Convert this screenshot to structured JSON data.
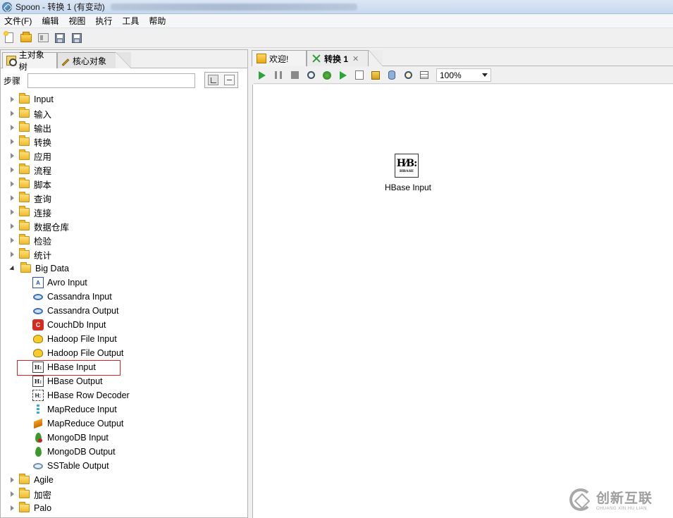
{
  "window": {
    "title": "Spoon - 转换 1 (有变动)"
  },
  "menu": [
    "文件(F)",
    "编辑",
    "视图",
    "执行",
    "工具",
    "帮助"
  ],
  "left_tabs": {
    "main_tree": "主对象树",
    "core_objects": "核心对象"
  },
  "steps": {
    "label": "步骤",
    "value": ""
  },
  "tree": {
    "folders_top": [
      "Input",
      "输入",
      "输出",
      "转换",
      "应用",
      "流程",
      "脚本",
      "查询",
      "连接",
      "数据仓库",
      "检验",
      "统计"
    ],
    "big_data": {
      "label": "Big Data",
      "items": [
        {
          "label": "Avro Input",
          "icon": "avro-icon"
        },
        {
          "label": "Cassandra Input",
          "icon": "cassandra-icon"
        },
        {
          "label": "Cassandra Output",
          "icon": "cassandra-icon"
        },
        {
          "label": "CouchDb Input",
          "icon": "couchdb-icon"
        },
        {
          "label": "Hadoop File Input",
          "icon": "hadoop-icon"
        },
        {
          "label": "Hadoop File Output",
          "icon": "hadoop-icon"
        },
        {
          "label": "HBase Input",
          "icon": "hbase-icon"
        },
        {
          "label": "HBase Output",
          "icon": "hbase-icon"
        },
        {
          "label": "HBase Row Decoder",
          "icon": "hbase-decoder-icon"
        },
        {
          "label": "MapReduce Input",
          "icon": "mapreduce-icon"
        },
        {
          "label": "MapReduce Output",
          "icon": "mapreduce-icon"
        },
        {
          "label": "MongoDB Input",
          "icon": "mongodb-icon"
        },
        {
          "label": "MongoDB Output",
          "icon": "mongodb-icon"
        },
        {
          "label": "SSTable Output",
          "icon": "sstable-icon"
        }
      ]
    },
    "folders_bottom": [
      "Agile",
      "加密",
      "Palo"
    ]
  },
  "editor_tabs": {
    "welcome": "欢迎!",
    "transformation": "转换 1",
    "close": "✕"
  },
  "zoom": {
    "value": "100%"
  },
  "canvas": {
    "node": {
      "icon_top": "H⁄B:",
      "icon_bottom": "HBASE",
      "label": "HBase Input"
    }
  },
  "watermark": {
    "cn": "创新互联",
    "en": "CHUANG XIN HU LIAN"
  },
  "colors": {
    "highlight": "#e02020",
    "run": "#2aa53a",
    "folder": "#f0b92a"
  }
}
